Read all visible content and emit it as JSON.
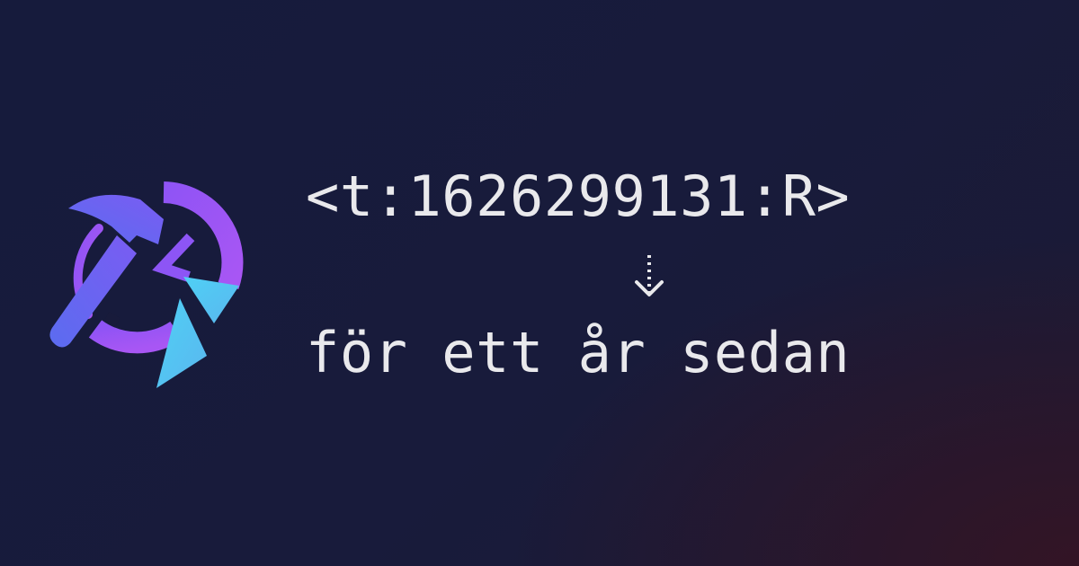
{
  "logo": {
    "icon": "hammer-clock-icon"
  },
  "timestamp_code": "<t:1626299131:R>",
  "arrow": {
    "icon": "dotted-arrow-down-icon"
  },
  "rendered_text": "för ett år sedan",
  "colors": {
    "text": "#e9e9ec",
    "hammer": "#5b6cf0",
    "clock": "#a855f7",
    "accent": "#56c8f2"
  }
}
